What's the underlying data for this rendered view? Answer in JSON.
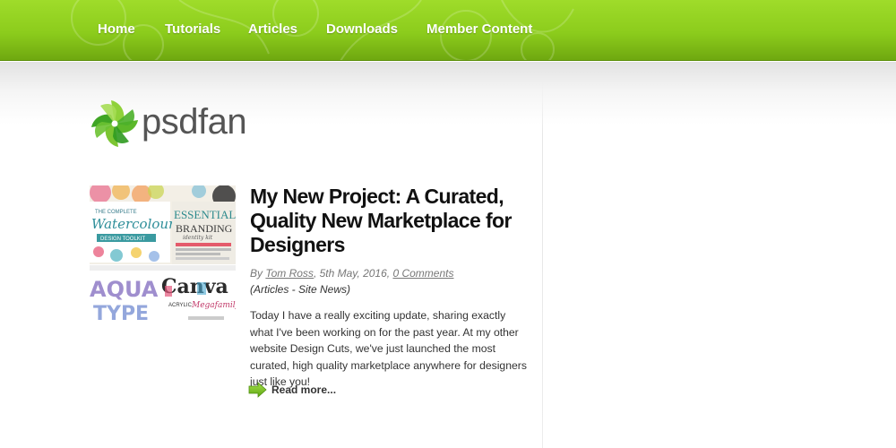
{
  "nav": {
    "items": [
      {
        "label": "Home"
      },
      {
        "label": "Tutorials"
      },
      {
        "label": "Articles"
      },
      {
        "label": "Downloads"
      },
      {
        "label": "Member Content"
      }
    ]
  },
  "logo": {
    "text": "psdfan",
    "icon": "pinwheel-icon"
  },
  "post": {
    "title": "My New Project: A Curated, Quality New Marketplace for Designers",
    "meta": {
      "by": "By",
      "author": "Tom Ross",
      "date": ", 5th May, 2016, ",
      "comments": "0 Comments"
    },
    "categories": "(Articles - Site News)",
    "excerpt": "Today I have a really exciting update, sharing exactly what I've been working on for the past year. At my other website Design Cuts, we've just launched the most curated, high quality marketplace anywhere for designers just like you!",
    "read_more": "Read more...",
    "read_more_icon": "green-arrow-icon",
    "thumbnail_text": {
      "t1": "THE COMPLETE",
      "t2": "Watercolour",
      "t3": "DESIGN TOOLKIT",
      "t4": "ESSENTIAL",
      "t5": "BRANDING",
      "t6": "identity kit",
      "t7": "AQUA",
      "t8": "TYPE",
      "t9": "Canva",
      "t10": "ACRYLIC",
      "t11": "Megafamily"
    }
  },
  "colors": {
    "nav_green": "#8ccc1c",
    "title": "#111111",
    "text": "#333333",
    "meta": "#777777"
  }
}
